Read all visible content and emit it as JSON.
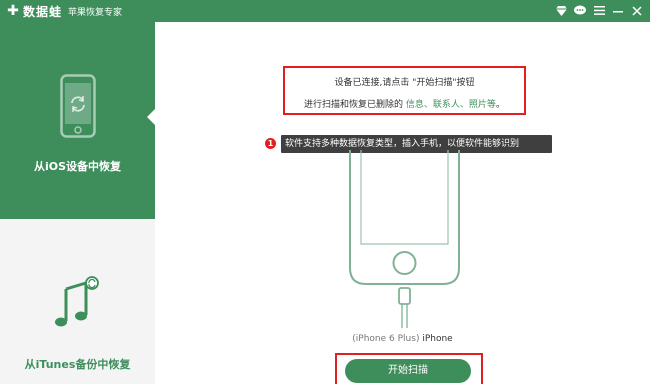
{
  "app": {
    "name": "数据蛙",
    "subtitle": "苹果恢复专家"
  },
  "sidebar": {
    "items": [
      {
        "label": "从iOS设备中恢复",
        "icon": "phone-sync-icon",
        "active": true
      },
      {
        "label": "从iTunes备份中恢复",
        "icon": "music-note-icon",
        "active": false
      }
    ]
  },
  "main": {
    "message": {
      "line1": "设备已连接,请点击 \"开始扫描\"按钮",
      "line2_prefix": "进行扫描和恢复已删除的 ",
      "line2_highlight": "信息、联系人、照片等",
      "line2_suffix": "。"
    },
    "tooltip": {
      "badge": "1",
      "text": "软件支持多种数据恢复类型，插入手机，以便软件能够识别"
    },
    "device": {
      "model": "(iPhone 6 Plus)",
      "name": "iPhone"
    },
    "scan_button": "开始扫描"
  },
  "colors": {
    "brand_green": "#3e8e5c",
    "highlight_red": "#e02020",
    "tooltip_bg": "#3f3f3f",
    "sidebar_bg": "#f4f4f4"
  }
}
